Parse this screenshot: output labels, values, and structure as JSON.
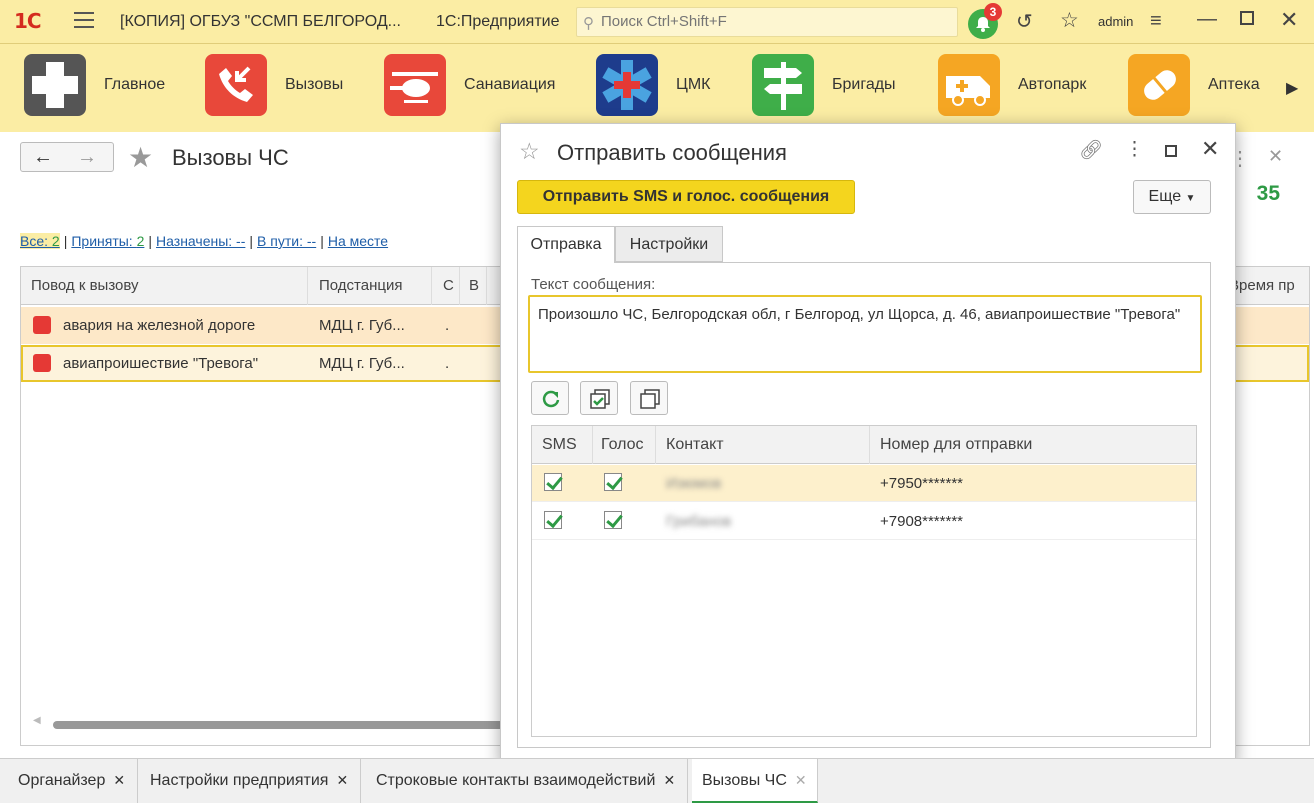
{
  "titlebar": {
    "logo": "1С",
    "window_title": "[КОПИЯ] ОГБУЗ \"ССМП БЕЛГОРОД...",
    "app_name": "1С:Предприятие",
    "search_placeholder": "Поиск Ctrl+Shift+F",
    "notifications_count": "3",
    "user": "admin"
  },
  "sections": [
    {
      "label": "Главное",
      "icon": "plus-icon",
      "color": "#555555"
    },
    {
      "label": "Вызовы",
      "icon": "phone-incoming-icon",
      "color": "#e8483a"
    },
    {
      "label": "Санавиация",
      "icon": "helicopter-icon",
      "color": "#e8483a"
    },
    {
      "label": "ЦМК",
      "icon": "medical-star-icon",
      "color": "#1e3c8c"
    },
    {
      "label": "Бригады",
      "icon": "signpost-icon",
      "color": "#3fae49"
    },
    {
      "label": "Автопарк",
      "icon": "ambulance-icon",
      "color": "#f5a623"
    },
    {
      "label": "Аптека",
      "icon": "pill-icon",
      "color": "#f5a623"
    }
  ],
  "main": {
    "title": "Вызовы ЧС",
    "counter": "35",
    "filters": [
      {
        "label": "Все: ",
        "count": "2"
      },
      {
        "label": "Приняты: ",
        "count": "2"
      },
      {
        "label": "Назначены: --",
        "count": ""
      },
      {
        "label": "В пути: --",
        "count": ""
      },
      {
        "label": "На месте",
        "count": ""
      }
    ],
    "columns": [
      "Повод к вызову",
      "Подстанция",
      "С",
      "В",
      "Время пр"
    ],
    "rows": [
      {
        "reason": "авария на железной дороге",
        "station": "МДЦ г. Губ...",
        "c": "."
      },
      {
        "reason": "авиапроишествие \"Тревога\"",
        "station": "МДЦ г. Губ...",
        "c": "."
      }
    ]
  },
  "dialog": {
    "title": "Отправить сообщения",
    "send_button": "Отправить SMS и голос. сообщения",
    "more_button": "Еще",
    "tabs": [
      "Отправка",
      "Настройки"
    ],
    "message_label": "Текст сообщения:",
    "message_text": "Произошло ЧС, Белгородская обл, г Белгород, ул Щорса, д. 46, авиапроишествие \"Тревога\"",
    "contacts_columns": [
      "SMS",
      "Голос",
      "Контакт",
      "Номер для отправки"
    ],
    "contacts": [
      {
        "sms": true,
        "voice": true,
        "name": "Изюмов",
        "number": "+7950*******"
      },
      {
        "sms": true,
        "voice": true,
        "name": "Грибанов",
        "number": "+7908*******"
      }
    ]
  },
  "bottom_tabs": [
    {
      "label": "Органайзер",
      "active": false
    },
    {
      "label": "Настройки предприятия",
      "active": false
    },
    {
      "label": "Строковые контакты взаимодействий",
      "active": false
    },
    {
      "label": "Вызовы ЧС",
      "active": true
    }
  ],
  "colors": {
    "accent": "#f4d51e",
    "topbar": "#fbeda4",
    "ok_green": "#2e9a45",
    "selection": "#fde8c8"
  }
}
